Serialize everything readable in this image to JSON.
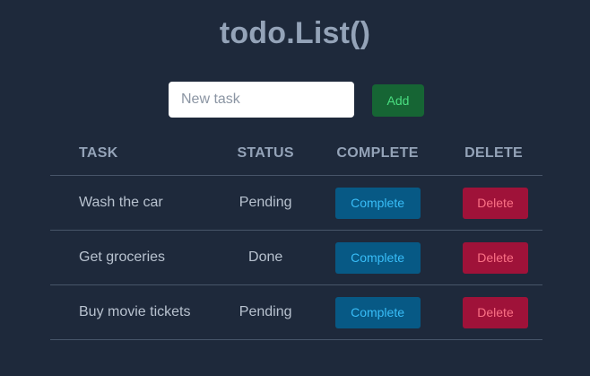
{
  "header": {
    "title": "todo.List()"
  },
  "new_task": {
    "placeholder": "New task",
    "value": "",
    "add_label": "Add"
  },
  "table": {
    "columns": [
      "TASK",
      "STATUS",
      "COMPLETE",
      "DELETE"
    ],
    "rows": [
      {
        "task": "Wash the car",
        "status": "Pending",
        "complete_label": "Complete",
        "delete_label": "Delete"
      },
      {
        "task": "Get groceries",
        "status": "Done",
        "complete_label": "Complete",
        "delete_label": "Delete"
      },
      {
        "task": "Buy movie tickets",
        "status": "Pending",
        "complete_label": "Complete",
        "delete_label": "Delete"
      }
    ]
  },
  "colors": {
    "background": "#1e293b",
    "add_button": "#166534",
    "complete_button": "#075985",
    "delete_button": "#9f1239"
  }
}
